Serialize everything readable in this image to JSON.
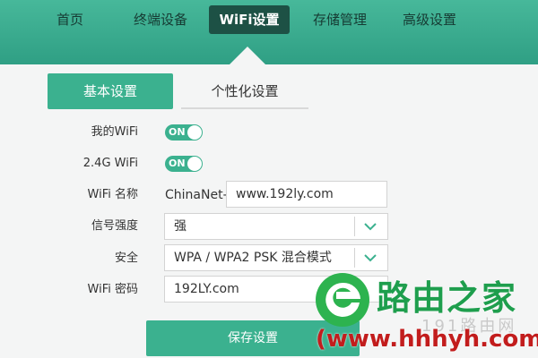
{
  "nav": {
    "items": [
      "首页",
      "终端设备",
      "WiFi设置",
      "存储管理",
      "高级设置"
    ],
    "active_index": 2
  },
  "subtabs": {
    "basic": "基本设置",
    "personal": "个性化设置"
  },
  "form": {
    "my_wifi_label": "我的WiFi",
    "my_wifi_state": "ON",
    "wifi24_label": "2.4G WiFi",
    "wifi24_state": "ON",
    "name_label": "WiFi 名称",
    "name_prefix": "ChinaNet-",
    "name_value": "www.192ly.com",
    "signal_label": "信号强度",
    "signal_value": "强",
    "security_label": "安全",
    "security_value": "WPA / WPA2 PSK 混合模式",
    "password_label": "WiFi 密码",
    "password_value": "192LY.com",
    "save_label": "保存设置"
  },
  "watermark": {
    "brand": "路由之家",
    "sub": "191路由网",
    "url": "(www.hhhyh.com)"
  },
  "colors": {
    "header": "#3aa98c",
    "accent": "#3bb18f",
    "nav_active": "#1d5145",
    "brand_green": "#1e9e4d",
    "url_red": "#c21d1d"
  }
}
